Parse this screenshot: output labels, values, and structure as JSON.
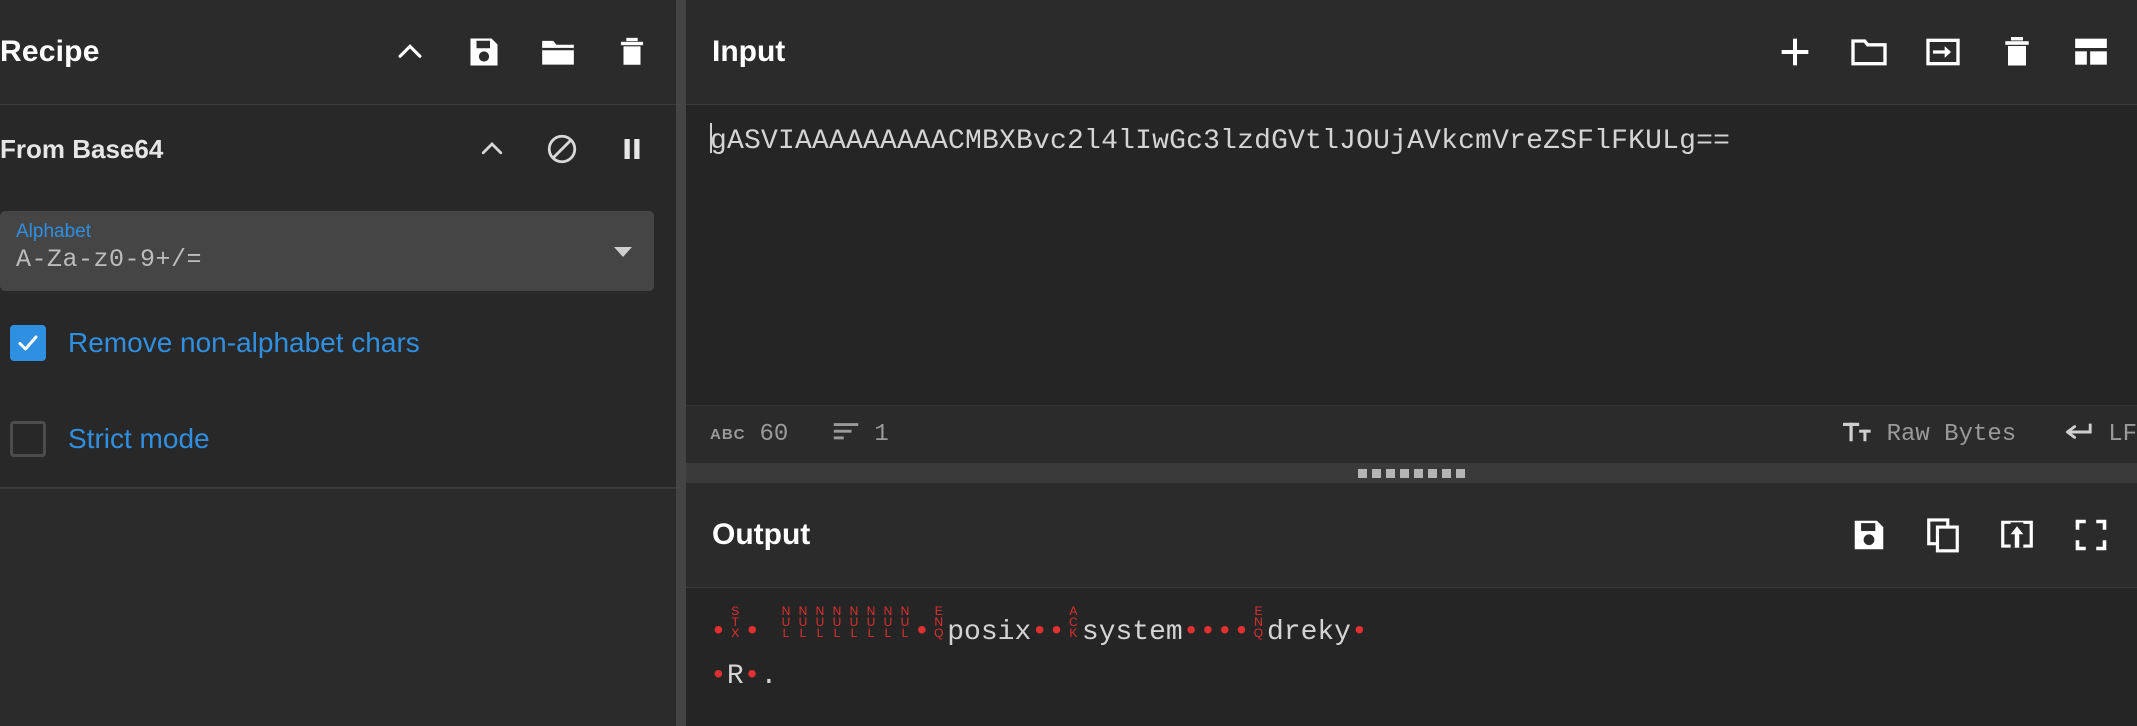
{
  "recipe": {
    "title": "Recipe",
    "toolbar": [
      {
        "name": "collapse-chevron-icon",
        "label": "Collapse"
      },
      {
        "name": "save-recipe-icon",
        "label": "Save recipe"
      },
      {
        "name": "load-recipe-icon",
        "label": "Load recipe"
      },
      {
        "name": "clear-recipe-icon",
        "label": "Clear recipe"
      }
    ],
    "operation": {
      "name": "From Base64",
      "icons": [
        {
          "name": "collapse-chevron-icon",
          "label": "Collapse"
        },
        {
          "name": "disable-operation-icon",
          "label": "Disable operation"
        },
        {
          "name": "breakpoint-pause-icon",
          "label": "Set breakpoint"
        }
      ],
      "alphabet_label": "Alphabet",
      "alphabet_value": "A-Za-z0-9+/=",
      "checkboxes": [
        {
          "label": "Remove non-alphabet chars",
          "checked": true
        },
        {
          "label": "Strict mode",
          "checked": false
        }
      ]
    }
  },
  "input": {
    "title": "Input",
    "toolbar": [
      {
        "name": "add-input-tab-icon",
        "label": "Add a new input tab"
      },
      {
        "name": "open-folder-icon",
        "label": "Open folder as input"
      },
      {
        "name": "open-file-icon",
        "label": "Open file as input"
      },
      {
        "name": "clear-input-icon",
        "label": "Clear input and output"
      },
      {
        "name": "reset-pane-layout-icon",
        "label": "Reset pane layout"
      }
    ],
    "value": "gASVIAAAAAAAAACMBXBvc2l4lIwGc3lzdGVtlJOUjAVkcmVreZSFlFKULg==",
    "status": {
      "length_icon": "ABC",
      "length": "60",
      "lines_icon": "lines-icon",
      "lines": "1",
      "font_icon": "Tt",
      "input_type": "Raw Bytes",
      "eol_icon": "return-arrow-icon",
      "eol": "LF"
    }
  },
  "output": {
    "title": "Output",
    "toolbar": [
      {
        "name": "save-output-icon",
        "label": "Save output to file"
      },
      {
        "name": "copy-output-icon",
        "label": "Copy raw output to clipboard"
      },
      {
        "name": "replace-input-icon",
        "label": "Replace input with output"
      },
      {
        "name": "maximise-output-icon",
        "label": "Maximise output pane"
      }
    ],
    "lines": [
      {
        "tokens": [
          {
            "t": "dot"
          },
          {
            "t": "ctrl",
            "a": "S",
            "b": "T",
            "c": "X"
          },
          {
            "t": "dot"
          },
          {
            "t": "text",
            "v": " "
          },
          {
            "t": "ctrl",
            "a": "N",
            "b": "U",
            "c": "L"
          },
          {
            "t": "ctrl",
            "a": "N",
            "b": "U",
            "c": "L"
          },
          {
            "t": "ctrl",
            "a": "N",
            "b": "U",
            "c": "L"
          },
          {
            "t": "ctrl",
            "a": "N",
            "b": "U",
            "c": "L"
          },
          {
            "t": "ctrl",
            "a": "N",
            "b": "U",
            "c": "L"
          },
          {
            "t": "ctrl",
            "a": "N",
            "b": "U",
            "c": "L"
          },
          {
            "t": "ctrl",
            "a": "N",
            "b": "U",
            "c": "L"
          },
          {
            "t": "ctrl",
            "a": "N",
            "b": "U",
            "c": "L"
          },
          {
            "t": "dot"
          },
          {
            "t": "ctrl",
            "a": "E",
            "b": "N",
            "c": "Q"
          },
          {
            "t": "text",
            "v": "posix"
          },
          {
            "t": "dot"
          },
          {
            "t": "dot"
          },
          {
            "t": "ctrl",
            "a": "A",
            "b": "C",
            "c": "K"
          },
          {
            "t": "text",
            "v": "system"
          },
          {
            "t": "dot"
          },
          {
            "t": "dot"
          },
          {
            "t": "dot"
          },
          {
            "t": "dot"
          },
          {
            "t": "ctrl",
            "a": "E",
            "b": "N",
            "c": "Q"
          },
          {
            "t": "text",
            "v": "dreky"
          },
          {
            "t": "dot"
          }
        ]
      },
      {
        "tokens": [
          {
            "t": "dot"
          },
          {
            "t": "text",
            "v": "R"
          },
          {
            "t": "dot"
          },
          {
            "t": "text",
            "v": "."
          }
        ]
      }
    ]
  },
  "colors": {
    "background": "#2b2b2b",
    "editor_bg": "#252525",
    "accent_blue": "#2f8fe0",
    "control_char_red": "#e03030",
    "text": "#d4d4d4"
  }
}
